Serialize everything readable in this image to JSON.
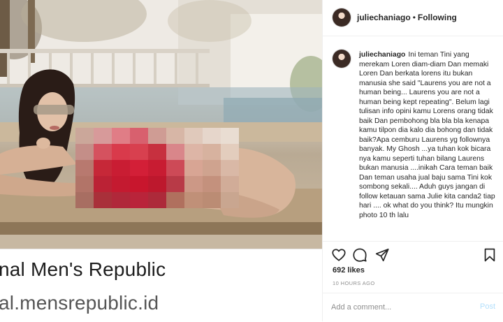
{
  "banner": {
    "title": "nal Men's Republic",
    "url": "al.mensrepublic.id"
  },
  "post": {
    "author": "juliechaniago",
    "separator": "•",
    "follow_status": "Following",
    "caption": "Ini teman Tini yang merekam Loren diam-diam Dan memaki Loren Dan berkata lorens itu bukan manusia she said \"Laurens you are not a human being... Laurens you are not a human being kept repeating\". Belum lagi tulisan info opini kamu Lorens orang tidak baik Dan pembohong bla bla bla kenapa kamu tilpon dia kalo dia bohong dan tidak baik?Apa cemburu Laurens yg follownya banyak. My Ghosh ...ya tuhan kok bicara nya kamu seperti tuhan bilang Laurens bukan manusia ....inikah Cara teman baik Dan teman usaha jual baju sama Tini kok sombong sekali.... Aduh guys jangan di follow ketauan sama Julie kita canda2 tiap hari .... ok what do you think? Itu mungkin photo 10 th lalu",
    "likes": "692 likes",
    "time_ago": "10 HOURS AGO"
  },
  "comment": {
    "placeholder": "Add a comment...",
    "post_label": "Post"
  },
  "icons": {
    "like": "heart-icon",
    "comment": "comment-icon",
    "share": "share-icon",
    "save": "bookmark-icon"
  },
  "colors": {
    "post_button": "#b2dffc",
    "muted_text": "#8e8e8e",
    "border": "#efefef"
  }
}
